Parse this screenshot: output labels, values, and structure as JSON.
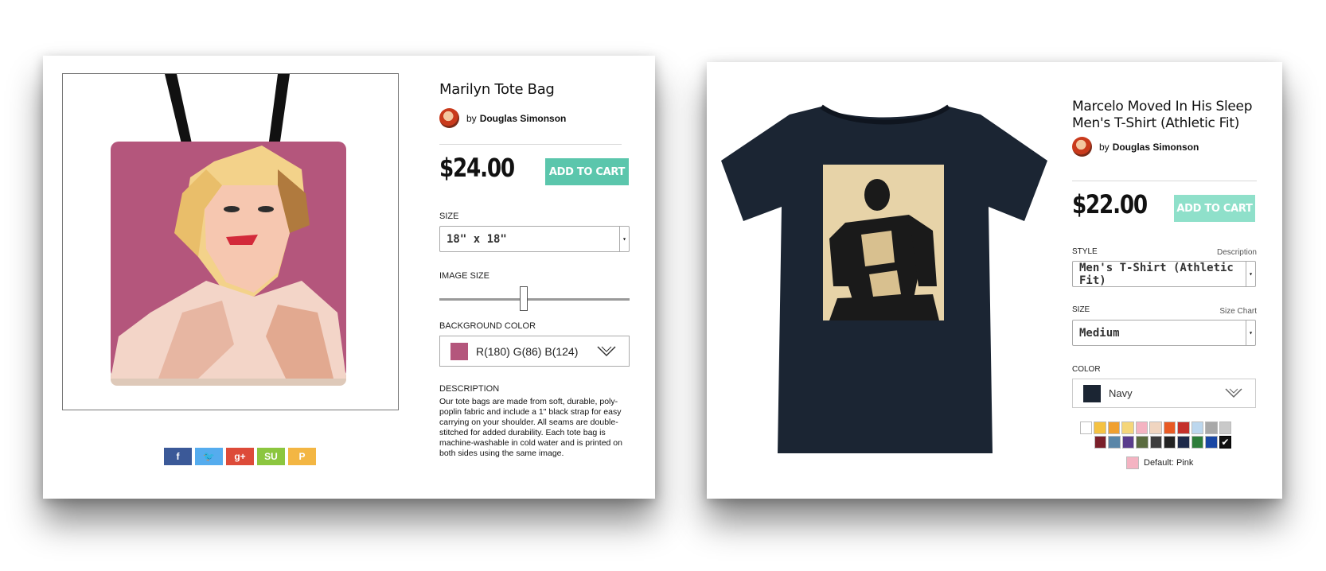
{
  "tote": {
    "title": "Marilyn Tote Bag",
    "by": "by",
    "artist": "Douglas Simonson",
    "price": "$24.00",
    "cart_label": "ADD TO CART",
    "size_label": "SIZE",
    "size_value": "18\" x 18\"",
    "image_size_label": "IMAGE SIZE",
    "image_size_level": 0.44,
    "bg_color_label": "BACKGROUND COLOR",
    "bg_color_value": "R(180) G(86) B(124)",
    "bg_color": "#b4567c",
    "description_label": "DESCRIPTION",
    "description": "Our tote bags are made from soft, durable, poly-poplin fabric and include a 1\" black strap for easy carrying on your shoulder.   All seams are double-stitched for added durability.   Each tote bag is machine-washable in cold water and is printed on both sides using the same image.",
    "social": [
      {
        "name": "facebook",
        "glyph": "f",
        "color": "#3b5998"
      },
      {
        "name": "twitter",
        "glyph": "🐦",
        "color": "#55acee"
      },
      {
        "name": "google-plus",
        "glyph": "g+",
        "color": "#dd4b39"
      },
      {
        "name": "stumbleupon",
        "glyph": "SU",
        "color": "#8cc63f"
      },
      {
        "name": "pinterest",
        "glyph": "P",
        "color": "#f3b643"
      }
    ]
  },
  "tshirt": {
    "title_line1": "Marcelo Moved In His Sleep",
    "title_line2": "Men's T-Shirt (Athletic Fit)",
    "by": "by",
    "artist": "Douglas Simonson",
    "price": "$22.00",
    "cart_label": "ADD TO CART",
    "style_label": "STYLE",
    "style_link": "Description",
    "style_value": "Men's T-Shirt (Athletic Fit)",
    "size_label": "SIZE",
    "size_link": "Size Chart",
    "size_value": "Medium",
    "color_label": "COLOR",
    "color_value": "Navy",
    "color_hex": "#1b2533",
    "swatches_row1": [
      "#ffffff",
      "#f5c242",
      "#f0a030",
      "#f5d67a",
      "#f4b3c2",
      "#f0d5c0",
      "#e85a24",
      "#c4302b",
      "#bcd7ee",
      "#a9a9a9",
      "#c9c9c9"
    ],
    "swatches_row2": [
      "#7a1f2a",
      "#5a86a8",
      "#5a3d8c",
      "#5a6b3f",
      "#3d3d3d",
      "#222222",
      "#1e2a4a",
      "#2e7d3a",
      "#1a47a3",
      "#111111"
    ],
    "default_label": "Default: Pink",
    "default_color": "#f4b3c2"
  },
  "colors": {
    "teal": "#5bc6ac",
    "teal_light": "#8fe0ca"
  }
}
